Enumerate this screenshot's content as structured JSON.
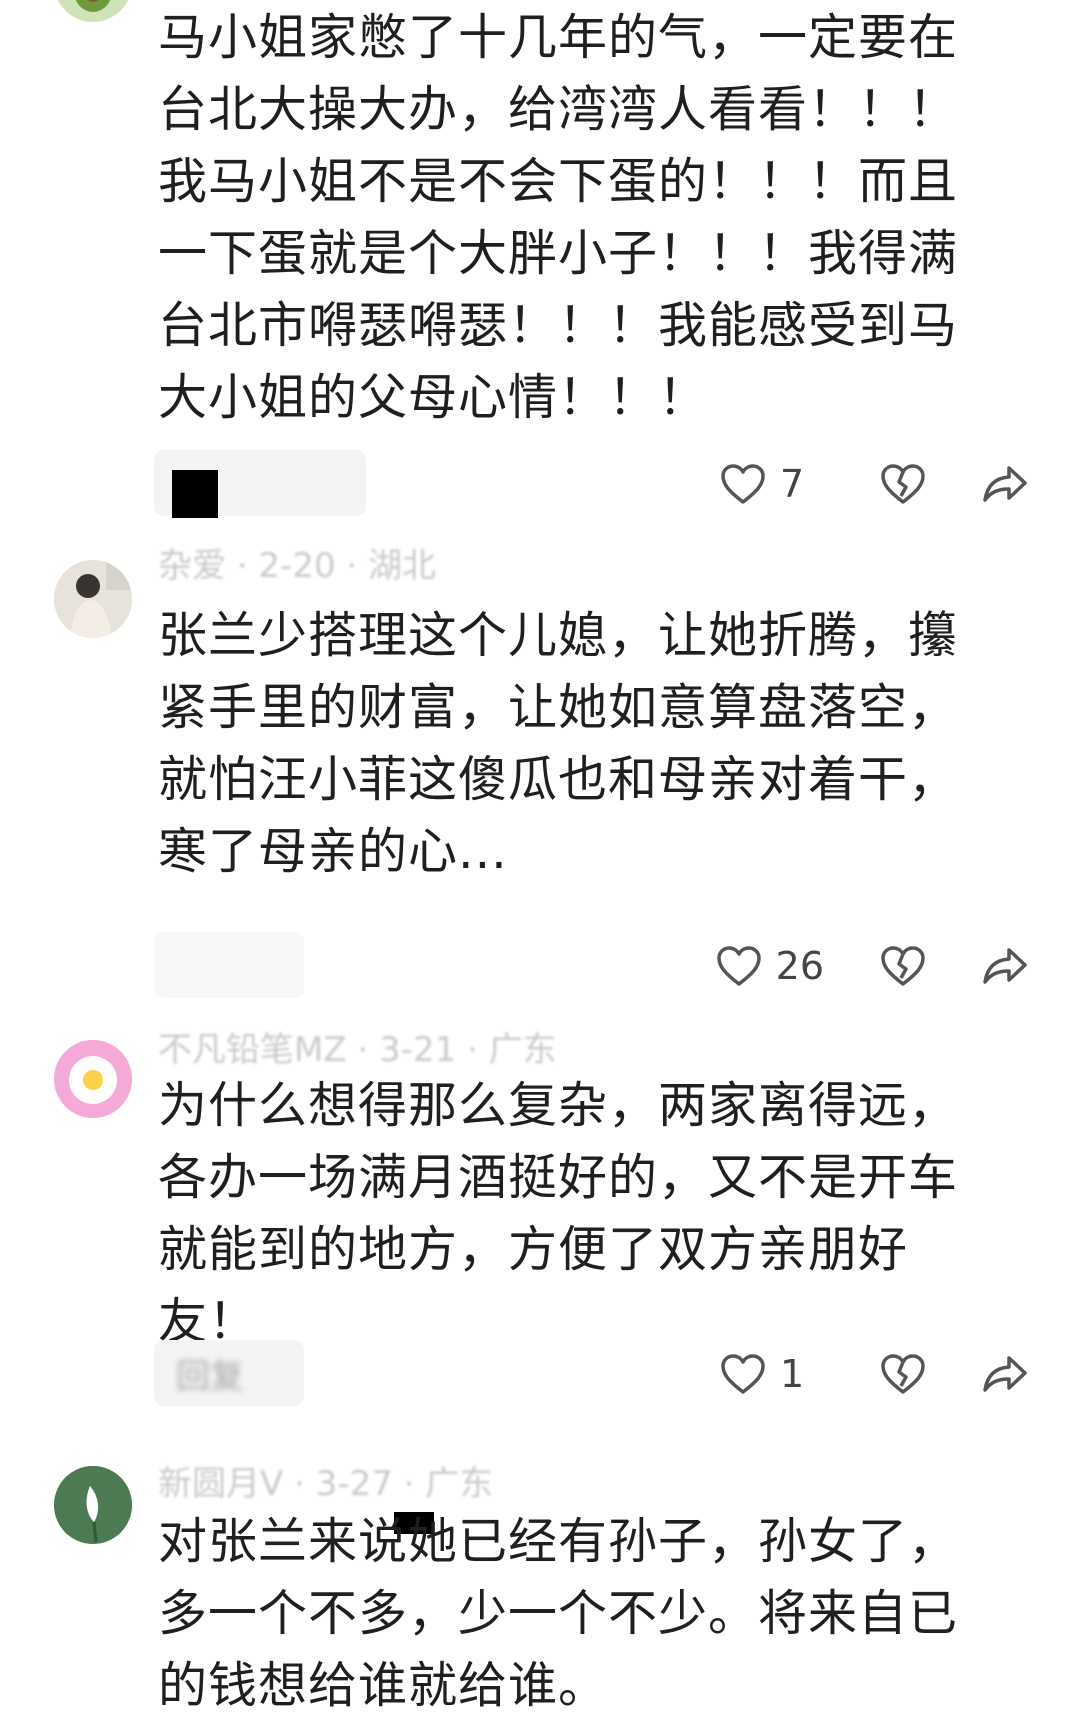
{
  "comments": [
    {
      "meta": "",
      "text": "马小姐家憋了十几年的气，一定要在台北大操大办，给湾湾人看看！！！我马小姐不是不会下蛋的！！！而且一下蛋就是个大胖小子！！！我得满台北市嘚瑟嘚瑟！！！我能感受到马大小姐的父母心情！！！",
      "reply_label": "",
      "likes": "7",
      "avatar_color": "#a9c98a"
    },
    {
      "meta": "杂爱 · 2-20 · 湖北",
      "text": "张兰少搭理这个儿媳，让她折腾，攥紧手里的财富，让她如意算盘落空，就怕汪小菲这傻瓜也和母亲对着干，寒了母亲的心...",
      "reply_label": "",
      "likes": "26",
      "avatar_color": "#cfc6bd"
    },
    {
      "meta": "不凡铅笔MZ · 3-21 · 广东",
      "text": "为什么想得那么复杂，两家离得远，各办一场满月酒挺好的，又不是开车就能到的地方，方便了双方亲朋好友！",
      "reply_label": "回复",
      "likes": "1",
      "avatar_color": "#f2a7d2"
    },
    {
      "meta": "新圆月V · 3-27 · 广东",
      "text": "对张兰来说她已经有孙子，孙女了，多一个不多，少一个不少。将来自已的钱想给谁就给谁。",
      "reply_label": "",
      "likes": "",
      "avatar_color": "#5d8d63"
    }
  ],
  "icons": {
    "like": "heart-outline-icon",
    "dislike": "broken-heart-icon",
    "share": "share-arrow-icon"
  }
}
